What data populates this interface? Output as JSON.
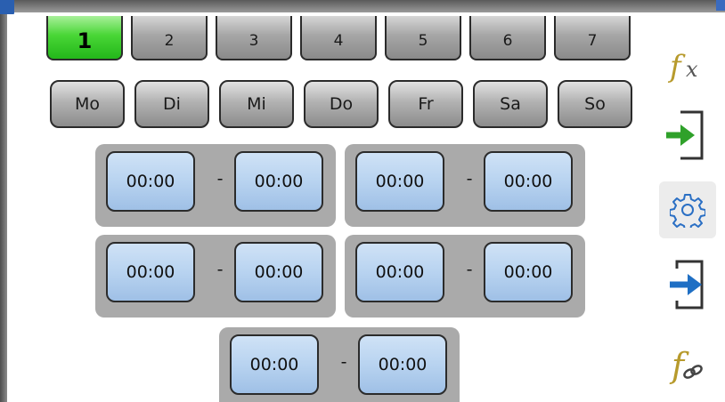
{
  "tabs": [
    {
      "label": "1",
      "active": true
    },
    {
      "label": "2",
      "active": false
    },
    {
      "label": "3",
      "active": false
    },
    {
      "label": "4",
      "active": false
    },
    {
      "label": "5",
      "active": false
    },
    {
      "label": "6",
      "active": false
    },
    {
      "label": "7",
      "active": false
    }
  ],
  "weekdays": [
    "Mo",
    "Di",
    "Mi",
    "Do",
    "Fr",
    "Sa",
    "So"
  ],
  "time_slots": [
    {
      "from": "00:00",
      "separator": "-",
      "to": "00:00"
    },
    {
      "from": "00:00",
      "separator": "-",
      "to": "00:00"
    },
    {
      "from": "00:00",
      "separator": "-",
      "to": "00:00"
    },
    {
      "from": "00:00",
      "separator": "-",
      "to": "00:00"
    },
    {
      "from": "00:00",
      "separator": "-",
      "to": "00:00"
    }
  ],
  "sidebar": {
    "items": [
      {
        "icon": "function-icon"
      },
      {
        "icon": "input-icon"
      },
      {
        "icon": "settings-icon",
        "selected": true
      },
      {
        "icon": "output-icon"
      },
      {
        "icon": "function-link-icon"
      }
    ]
  },
  "colors": {
    "tab_active": "#3fcf2f",
    "button_gray": "#a6a6a6",
    "time_field": "#b8d3f0",
    "slot_background": "#aaaaaa",
    "arrow_green": "#2fa12a",
    "arrow_blue": "#1f6fc4",
    "fx_gold": "#b79a2c"
  }
}
